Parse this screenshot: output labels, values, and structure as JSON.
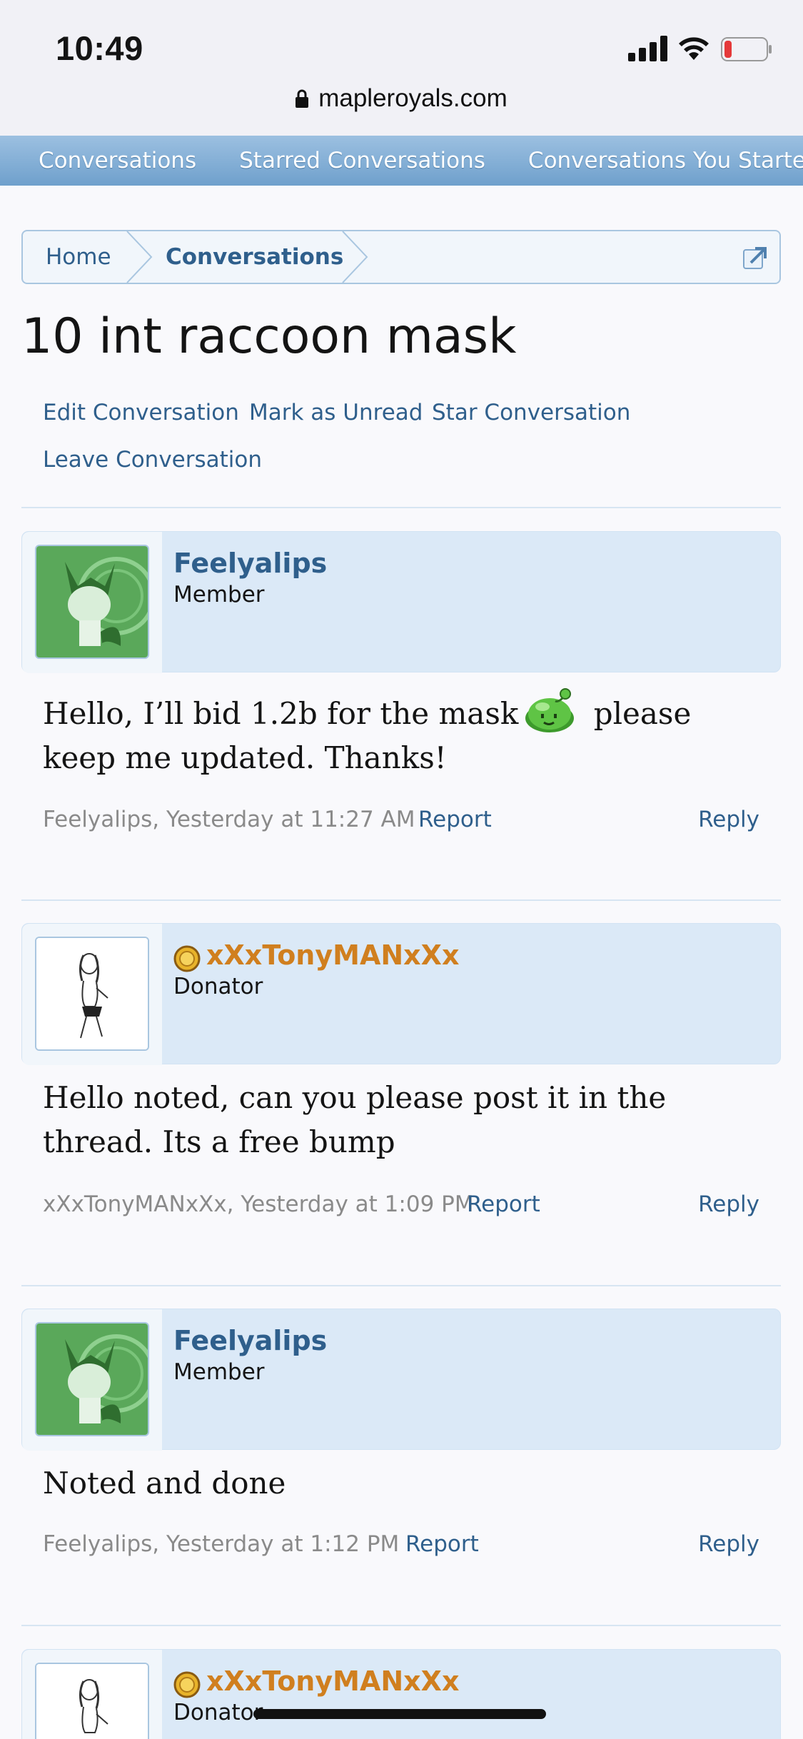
{
  "status": {
    "time": "10:49",
    "url": "mapleroyals.com"
  },
  "tabs": [
    "Conversations",
    "Starred Conversations",
    "Conversations You Started"
  ],
  "breadcrumb": {
    "home": "Home",
    "current": "Conversations"
  },
  "title": "10 int raccoon mask",
  "actions": {
    "edit": "Edit Conversation",
    "unread": "Mark as Unread",
    "star": "Star Conversation",
    "leave": "Leave Conversation"
  },
  "messages": [
    {
      "user": "Feelyalips",
      "role": "Member",
      "text_a": "Hello, I’ll bid 1.2b for the mask",
      "text_b": " please keep me updated. Thanks!",
      "meta": "Feelyalips, Yesterday at 11:27 AM",
      "report": "Report",
      "reply": "Reply"
    },
    {
      "user": "xXxTonyMANxXx",
      "role": "Donator",
      "text": "Hello noted, can you please post it in the thread. Its a free bump",
      "meta": "xXxTonyMANxXx, Yesterday at 1:09 PM",
      "report": "Report",
      "reply": "Reply"
    },
    {
      "user": "Feelyalips",
      "role": "Member",
      "text": "Noted and done",
      "meta": "Feelyalips, Yesterday at 1:12 PM",
      "report": "Report",
      "reply": "Reply"
    },
    {
      "user": "xXxTonyMANxXx",
      "role": "Donator"
    }
  ],
  "colors": {
    "link": "#2f5f8c",
    "donor_name": "#d07f1f",
    "header_bg": "#dbe9f7",
    "tab_bar": "#7eaad3"
  }
}
